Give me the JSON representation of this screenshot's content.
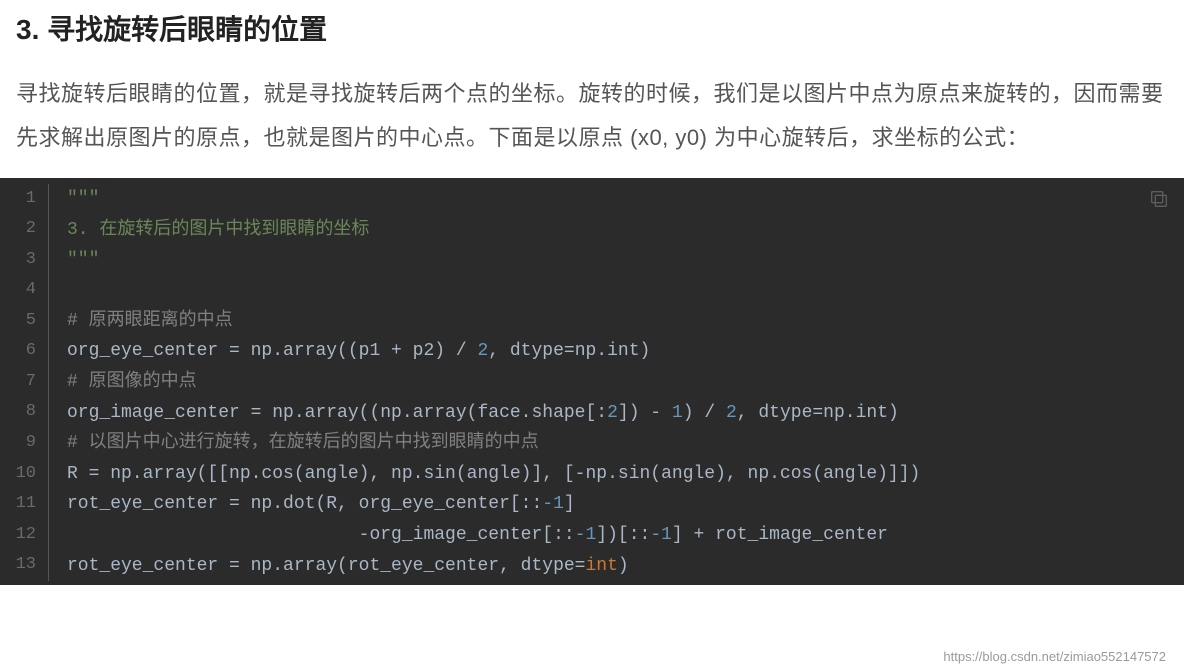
{
  "heading": "3. 寻找旋转后眼睛的位置",
  "paragraph": "寻找旋转后眼睛的位置，就是寻找旋转后两个点的坐标。旋转的时候，我们是以图片中点为原点来旋转的，因而需要先求解出原图片的原点，也就是图片的中心点。下面是以原点 (x0, y0) 为中心旋转后，求坐标的公式：",
  "code": {
    "lines": [
      {
        "n": "1",
        "segments": [
          {
            "cls": "tok-str",
            "text": "\"\"\""
          }
        ]
      },
      {
        "n": "2",
        "segments": [
          {
            "cls": "tok-str",
            "text": "3. 在旋转后的图片中找到眼睛的坐标"
          }
        ]
      },
      {
        "n": "3",
        "segments": [
          {
            "cls": "tok-str",
            "text": "\"\"\""
          }
        ]
      },
      {
        "n": "4",
        "segments": []
      },
      {
        "n": "5",
        "segments": [
          {
            "cls": "tok-cmt",
            "text": "# 原两眼距离的中点"
          }
        ]
      },
      {
        "n": "6",
        "segments": [
          {
            "cls": "tok-def",
            "text": "org_eye_center = np.array((p1 + p2) / "
          },
          {
            "cls": "tok-num",
            "text": "2"
          },
          {
            "cls": "tok-def",
            "text": ", dtype=np.int)"
          }
        ]
      },
      {
        "n": "7",
        "segments": [
          {
            "cls": "tok-cmt",
            "text": "# 原图像的中点"
          }
        ]
      },
      {
        "n": "8",
        "segments": [
          {
            "cls": "tok-def",
            "text": "org_image_center = np.array((np.array(face.shape[:"
          },
          {
            "cls": "tok-num",
            "text": "2"
          },
          {
            "cls": "tok-def",
            "text": "]) - "
          },
          {
            "cls": "tok-num",
            "text": "1"
          },
          {
            "cls": "tok-def",
            "text": ") / "
          },
          {
            "cls": "tok-num",
            "text": "2"
          },
          {
            "cls": "tok-def",
            "text": ", dtype=np.int)"
          }
        ]
      },
      {
        "n": "9",
        "segments": [
          {
            "cls": "tok-cmt",
            "text": "# 以图片中心进行旋转，在旋转后的图片中找到眼睛的中点"
          }
        ]
      },
      {
        "n": "10",
        "segments": [
          {
            "cls": "tok-def",
            "text": "R = np.array([[np.cos(angle), np.sin(angle)], [-np.sin(angle), np.cos(angle)]])"
          }
        ]
      },
      {
        "n": "11",
        "segments": [
          {
            "cls": "tok-def",
            "text": "rot_eye_center = np.dot(R, org_eye_center[::"
          },
          {
            "cls": "tok-num",
            "text": "-1"
          },
          {
            "cls": "tok-def",
            "text": "]"
          }
        ]
      },
      {
        "n": "12",
        "segments": [
          {
            "cls": "tok-def",
            "text": "                           -org_image_center[::"
          },
          {
            "cls": "tok-num",
            "text": "-1"
          },
          {
            "cls": "tok-def",
            "text": "])[::"
          },
          {
            "cls": "tok-num",
            "text": "-1"
          },
          {
            "cls": "tok-def",
            "text": "] + rot_image_center"
          }
        ]
      },
      {
        "n": "13",
        "segments": [
          {
            "cls": "tok-def",
            "text": "rot_eye_center = np.array(rot_eye_center, dtype="
          },
          {
            "cls": "tok-kw",
            "text": "int"
          },
          {
            "cls": "tok-def",
            "text": ")"
          }
        ]
      }
    ]
  },
  "watermark": "https://blog.csdn.net/zimiao552147572"
}
